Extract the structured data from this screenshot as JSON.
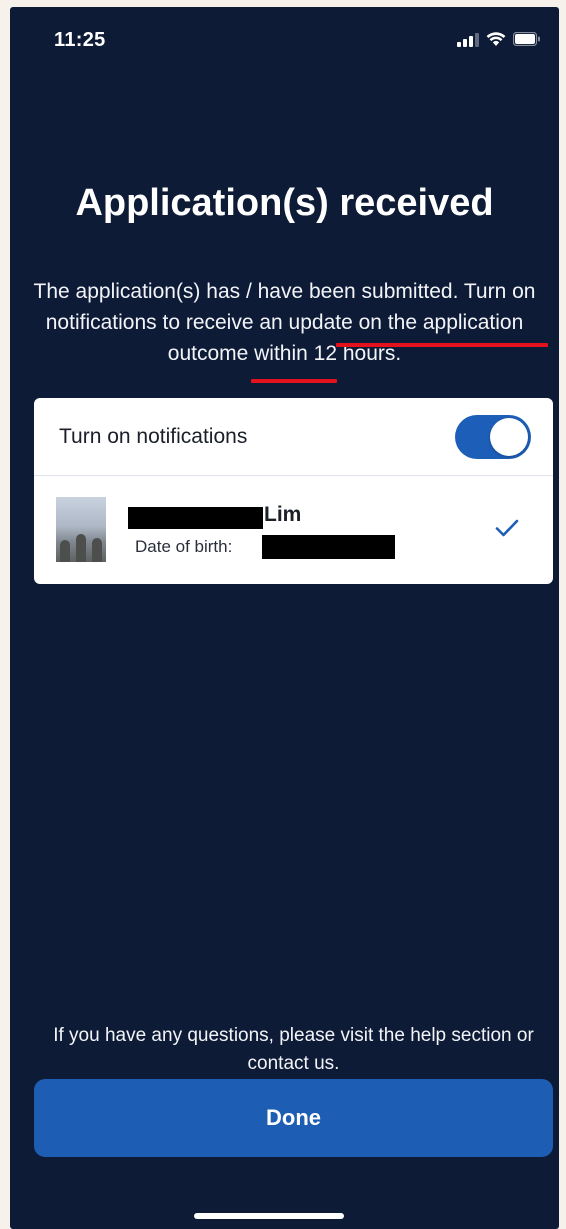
{
  "status_bar": {
    "time": "11:25",
    "icons": [
      "signal-icon",
      "wifi-icon",
      "battery-icon"
    ]
  },
  "page": {
    "title": "Application(s) received",
    "description": "The application(s) has / have been submitted. Turn on notifications to receive an update on the application outcome within 12 hours.",
    "highlighted_phrase": "outcome within 12 hours."
  },
  "card": {
    "notifications": {
      "label": "Turn on notifications",
      "enabled": true
    },
    "applicant": {
      "name_visible_part": "Lim",
      "dob_label": "Date of birth:",
      "selected": true
    }
  },
  "footer": {
    "help_text": "If you have any questions, please visit the help section or contact us.",
    "done_label": "Done"
  },
  "colors": {
    "background": "#0d1b36",
    "accent": "#1d5db3",
    "annotation_underline": "#e3121c"
  }
}
